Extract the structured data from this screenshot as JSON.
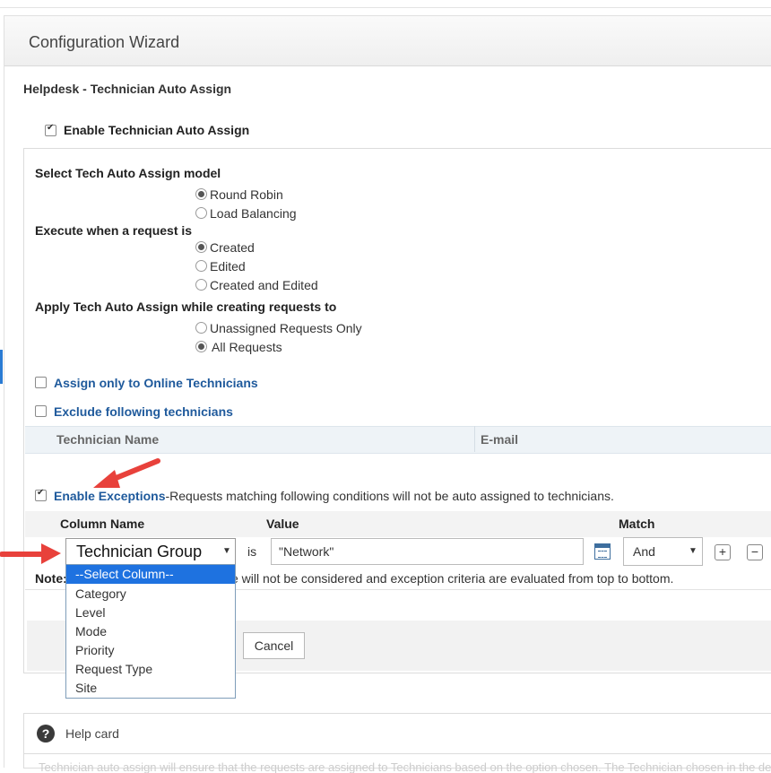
{
  "window": {
    "title": "Configuration Wizard"
  },
  "page": {
    "title": "Helpdesk - Technician Auto Assign"
  },
  "enable_auto_assign": {
    "label": "Enable Technician Auto Assign",
    "checked": true
  },
  "model": {
    "label": "Select Tech Auto Assign model",
    "options": [
      "Round Robin",
      "Load Balancing"
    ],
    "selected": "Round Robin"
  },
  "execute": {
    "label": "Execute when a request is",
    "options": [
      "Created",
      "Edited",
      "Created and Edited"
    ],
    "selected": "Created"
  },
  "apply": {
    "label": "Apply Tech Auto Assign while creating requests to",
    "options": [
      "Unassigned Requests Only",
      "All Requests"
    ],
    "selected": "All Requests"
  },
  "online_only": {
    "label": "Assign only to Online Technicians",
    "checked": false
  },
  "exclude": {
    "label": "Exclude following technicians",
    "checked": false,
    "columns": [
      "Technician Name",
      "E-mail"
    ]
  },
  "exceptions": {
    "label": "Enable Exceptions",
    "description": "-Requests matching following conditions will not be auto assigned to technicians.",
    "checked": true,
    "columns": [
      "Column Name",
      "Value",
      "Match"
    ],
    "row": {
      "column": "Technician Group",
      "operator": "is",
      "value": "\"Network\"",
      "match": "And"
    },
    "add_label": "+",
    "remove_label": "−",
    "note_prefix": "Note:",
    "note_text": "e will not be considered and exception criteria are evaluated from top to bottom."
  },
  "column_dropdown": {
    "options": [
      "--Select Column--",
      "Category",
      "Level",
      "Mode",
      "Priority",
      "Request Type",
      "Site"
    ],
    "highlighted": "--Select Column--"
  },
  "buttons": {
    "cancel": "Cancel"
  },
  "help_card": {
    "icon": "?",
    "title": "Help card",
    "text": "Technician auto assign will ensure that the requests are assigned to Technicians based on the option chosen. The Technician chosen in the default"
  },
  "colors": {
    "accent": "#2a7bd3",
    "link": "#1f5a9c",
    "highlight": "#1e72e0",
    "arrow": "#e8413b"
  }
}
